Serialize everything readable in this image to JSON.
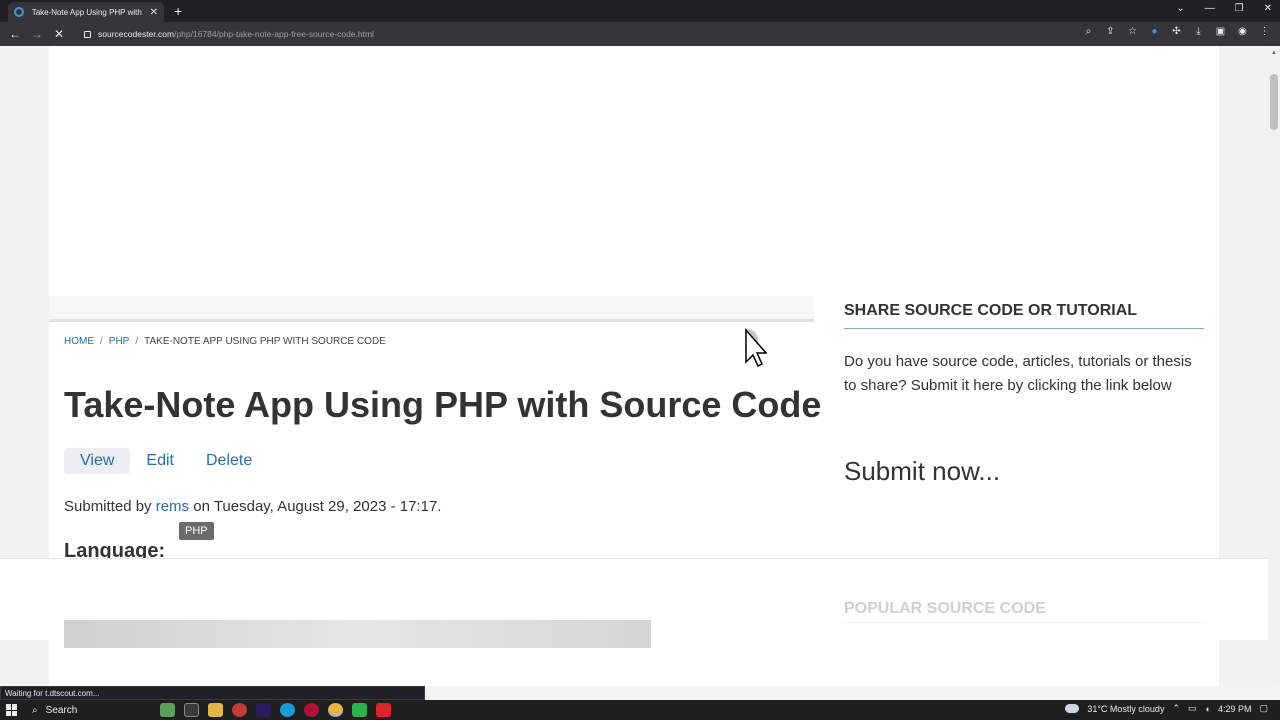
{
  "browser": {
    "tab_title": "Take-Note App Using PHP with S",
    "new_tab": "+",
    "url_host": "sourcecodester.com",
    "url_path": "/php/16784/php-take-note-app-free-source-code.html",
    "status_text": "Waiting for t.dtscout.com..."
  },
  "page": {
    "breadcrumb": [
      "HOME",
      "PHP",
      "TAKE-NOTE APP USING PHP WITH SOURCE CODE"
    ],
    "breadcrumb_sep": "/",
    "title": "Take-Note App Using PHP with Source Code",
    "tabs": [
      "View",
      "Edit",
      "Delete"
    ],
    "submitted_prefix": "Submitted by",
    "author": "rems",
    "submitted_suffix": "on Tuesday, August 29, 2023 - 17:17.",
    "tooltip": "PHP",
    "language_label": "Language:"
  },
  "sidebar": {
    "heading": "SHARE SOURCE CODE OR TUTORIAL",
    "text": "Do you have source code, articles, tutorials or thesis to share? Submit it here by clicking the link below",
    "submit_link": "Submit now...",
    "popular_heading": "POPULAR SOURCE CODE"
  },
  "taskbar": {
    "search_label": "Search",
    "weather": "31°C  Mostly cloudy",
    "time": "4:29 PM"
  },
  "colors": {
    "link": "#2f6ba5",
    "heading": "#333333"
  }
}
